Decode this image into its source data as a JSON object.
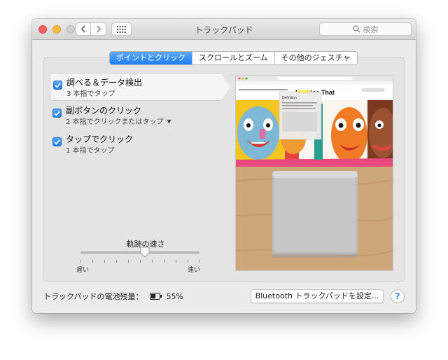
{
  "window": {
    "title": "トラックパッド",
    "search_placeholder": "検索"
  },
  "tabs": [
    {
      "label": "ポイントとクリック",
      "active": true
    },
    {
      "label": "スクロールとズーム",
      "active": false
    },
    {
      "label": "その他のジェスチャ",
      "active": false
    }
  ],
  "options": [
    {
      "title": "調べる＆データ検出",
      "subtitle": "3 本指でタップ",
      "checked": true,
      "selected": true
    },
    {
      "title": "副ボタンのクリック",
      "subtitle": "2 本指でクリックまたはタップ",
      "checked": true,
      "selected": false
    },
    {
      "title": "タップでクリック",
      "subtitle": "1 本指でタップ",
      "checked": true,
      "selected": false
    }
  ],
  "tracking_speed": {
    "label": "軌跡の速さ",
    "min_label": "遅い",
    "max_label": "速い",
    "value_fraction": 0.55
  },
  "preview": {
    "page_title": "It's Nice That",
    "popup_title": "Definition"
  },
  "footer": {
    "battery_label": "トラックパッドの電池残量：",
    "battery_percent": "55%",
    "bluetooth_button": "Bluetooth トラックパッドを設定...",
    "help_label": "?"
  },
  "colors": {
    "accent": "#1d7ff5",
    "close": "#fc605c",
    "minimize": "#fdbc40"
  }
}
